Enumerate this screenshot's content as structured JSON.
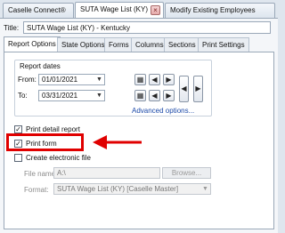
{
  "doc_tabs": [
    {
      "label": "Caselle Connect®",
      "active": false
    },
    {
      "label": "SUTA Wage List (KY)",
      "active": true
    },
    {
      "label": "Modify Existing Employees",
      "active": false
    }
  ],
  "title_label": "Title:",
  "title_value": "SUTA Wage List (KY) - Kentucky",
  "sub_tabs": [
    "Report Options",
    "State Options",
    "Forms",
    "Columns",
    "Sections",
    "Print Settings"
  ],
  "report_dates": {
    "heading": "Report dates",
    "from_label": "From:",
    "from_value": "01/01/2021",
    "to_label": "To:",
    "to_value": "03/31/2021"
  },
  "advanced_link": "Advanced options...",
  "options": {
    "print_detail": {
      "label": "Print detail report",
      "checked": true
    },
    "print_form": {
      "label": "Print form",
      "checked": true
    },
    "electronic_file": {
      "label": "Create electronic file",
      "checked": false
    }
  },
  "file_name": {
    "label": "File name:",
    "value": "A:\\",
    "browse": "Browse..."
  },
  "format": {
    "label": "Format:",
    "value": "SUTA Wage List (KY) [Caselle Master]"
  },
  "colors": {
    "highlight": "#e00000",
    "accent": "#1b49a8"
  }
}
